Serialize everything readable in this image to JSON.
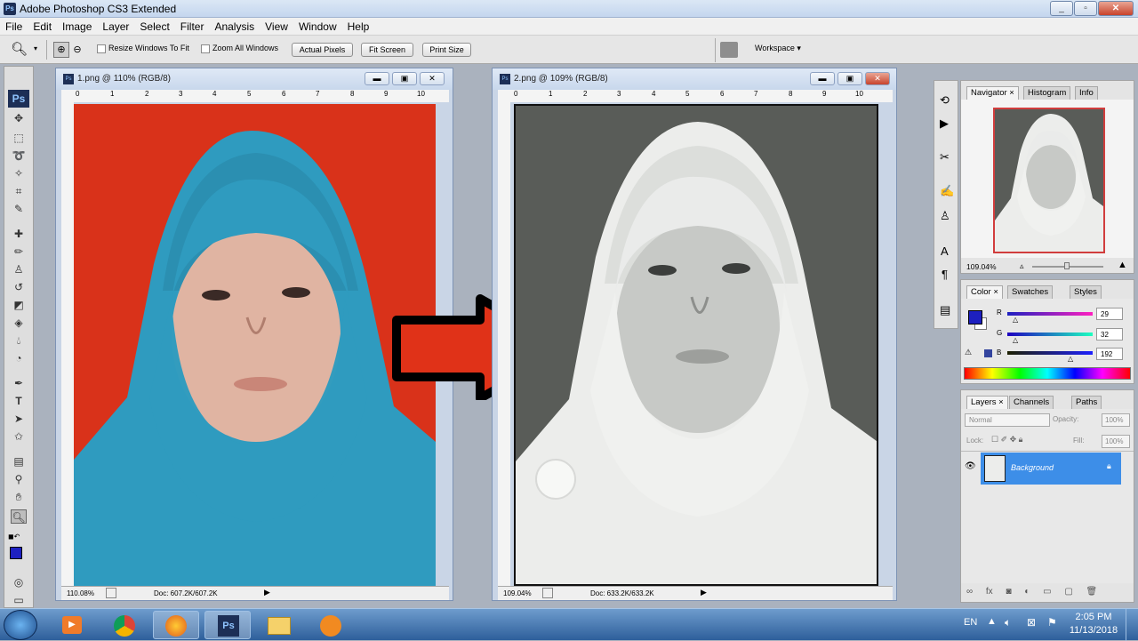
{
  "app": {
    "title": "Adobe Photoshop CS3 Extended",
    "icon": "Ps"
  },
  "menu": [
    "File",
    "Edit",
    "Image",
    "Layer",
    "Select",
    "Filter",
    "Analysis",
    "View",
    "Window",
    "Help"
  ],
  "options": {
    "resize_windows": "Resize Windows To Fit",
    "zoom_all": "Zoom All Windows",
    "actual_pixels": "Actual Pixels",
    "fit_screen": "Fit Screen",
    "print_size": "Print Size",
    "workspace": "Workspace ▾"
  },
  "docs": [
    {
      "title": "1.png @ 110% (RGB/8)",
      "zoom": "110.08%",
      "doc": "Doc: 607.2K/607.2K"
    },
    {
      "title": "2.png @ 109% (RGB/8)",
      "zoom": "109.04%",
      "doc": "Doc: 633.2K/633.2K"
    }
  ],
  "ruler_labels": [
    "0",
    "1",
    "2",
    "3",
    "4",
    "5",
    "6",
    "7",
    "8",
    "9",
    "10"
  ],
  "navigator": {
    "tabs": [
      "Navigator",
      "Histogram",
      "Info"
    ],
    "zoom": "109.04%"
  },
  "color": {
    "tabs": [
      "Color",
      "Swatches",
      "Styles"
    ],
    "r_label": "R",
    "g_label": "G",
    "b_label": "B",
    "r": "29",
    "g": "32",
    "b": "192",
    "fg": "#1d20c0"
  },
  "layers": {
    "tabs": [
      "Layers",
      "Channels",
      "Paths"
    ],
    "blend": "Normal",
    "opacity_label": "Opacity:",
    "opacity": "100%",
    "lock_label": "Lock:",
    "fill_label": "Fill:",
    "fill": "100%",
    "layer_name": "Background"
  },
  "taskbar": {
    "lang": "EN",
    "time": "2:05 PM",
    "date": "11/13/2018"
  },
  "colors": {
    "red_bg": "#d9321a",
    "hijab": "#2f9bbf",
    "gray_bg": "#595c58",
    "arrow": "#e03218"
  }
}
